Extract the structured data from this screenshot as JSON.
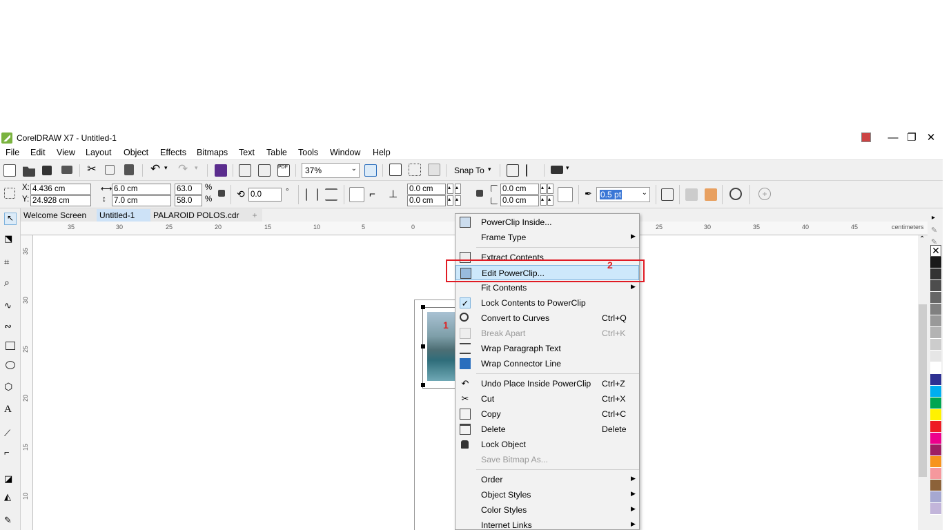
{
  "window": {
    "title": "CorelDRAW X7 - Untitled-1",
    "controls": {
      "minimize": "—",
      "restore": "❐",
      "close": "✕"
    }
  },
  "menubar": [
    "File",
    "Edit",
    "View",
    "Layout",
    "Object",
    "Effects",
    "Bitmaps",
    "Text",
    "Table",
    "Tools",
    "Window",
    "Help"
  ],
  "standard_toolbar": {
    "zoom_level": "37%",
    "snap_to_label": "Snap To"
  },
  "property_bar": {
    "x_label": "X:",
    "x_value": "4.436 cm",
    "y_label": "Y:",
    "y_value": "24.928 cm",
    "width_value": "6.0 cm",
    "height_value": "7.0 cm",
    "scale_w": "63.0",
    "scale_h": "58.0",
    "percent_symbol": "%",
    "rotation_value": "0.0",
    "degree_symbol": "°",
    "corner_1": "0.0 cm",
    "corner_2": "0.0 cm",
    "corner_3": "0.0 cm",
    "corner_4": "0.0 cm",
    "outline_width": "0.5 pt"
  },
  "tabs": [
    "Welcome Screen",
    "Untitled-1",
    "PALAROID POLOS.cdr"
  ],
  "active_tab": "Untitled-1",
  "tab_add": "+",
  "ruler": {
    "units": "centimeters",
    "h_ticks": [
      "35",
      "30",
      "25",
      "20",
      "15",
      "10",
      "5",
      "0",
      "25",
      "30",
      "35",
      "40",
      "45"
    ],
    "v_ticks": [
      "35",
      "30",
      "25",
      "20",
      "15",
      "10"
    ]
  },
  "annotations": {
    "step1": "1",
    "step2": "2"
  },
  "context_menu": [
    {
      "label": "PowerClip Inside...",
      "icon": "powerclip-inside-icon"
    },
    {
      "label": "Frame Type",
      "submenu": true
    },
    {
      "separator": true
    },
    {
      "label": "Extract Contents",
      "icon": "extract-contents-icon"
    },
    {
      "label": "Edit PowerClip...",
      "icon": "edit-powerclip-icon",
      "highlighted": true
    },
    {
      "label": "Fit Contents",
      "submenu": true
    },
    {
      "label": "Lock Contents to PowerClip",
      "icon": "check-icon"
    },
    {
      "label": "Convert to Curves",
      "shortcut": "Ctrl+Q",
      "icon": "convert-curves-icon"
    },
    {
      "label": "Break Apart",
      "shortcut": "Ctrl+K",
      "disabled": true,
      "icon": "break-apart-icon"
    },
    {
      "label": "Wrap Paragraph Text",
      "icon": "wrap-text-icon"
    },
    {
      "label": "Wrap Connector Line",
      "icon": "wrap-connector-icon"
    },
    {
      "separator": true
    },
    {
      "label": "Undo Place Inside PowerClip",
      "shortcut": "Ctrl+Z",
      "icon": "undo-icon"
    },
    {
      "label": "Cut",
      "shortcut": "Ctrl+X",
      "icon": "cut-icon"
    },
    {
      "label": "Copy",
      "shortcut": "Ctrl+C",
      "icon": "copy-icon"
    },
    {
      "label": "Delete",
      "shortcut": "Delete",
      "icon": "delete-icon"
    },
    {
      "label": "Lock Object",
      "icon": "lock-icon"
    },
    {
      "label": "Save Bitmap As...",
      "disabled": true
    },
    {
      "separator": true
    },
    {
      "label": "Order",
      "submenu": true
    },
    {
      "label": "Object Styles",
      "submenu": true
    },
    {
      "label": "Color Styles",
      "submenu": true
    },
    {
      "label": "Internet Links",
      "submenu": true
    }
  ],
  "palette_colors": [
    "#1a1a1a",
    "#333333",
    "#4d4d4d",
    "#666666",
    "#808080",
    "#999999",
    "#b3b3b3",
    "#cccccc",
    "#e6e6e6",
    "#ffffff",
    "#2e3192",
    "#00aeef",
    "#00a651",
    "#fff200",
    "#ed1c24",
    "#ec008c",
    "#9e1f63",
    "#f7941d",
    "#f5989d",
    "#8c6239",
    "#a6a8d1",
    "#c2b5da"
  ]
}
